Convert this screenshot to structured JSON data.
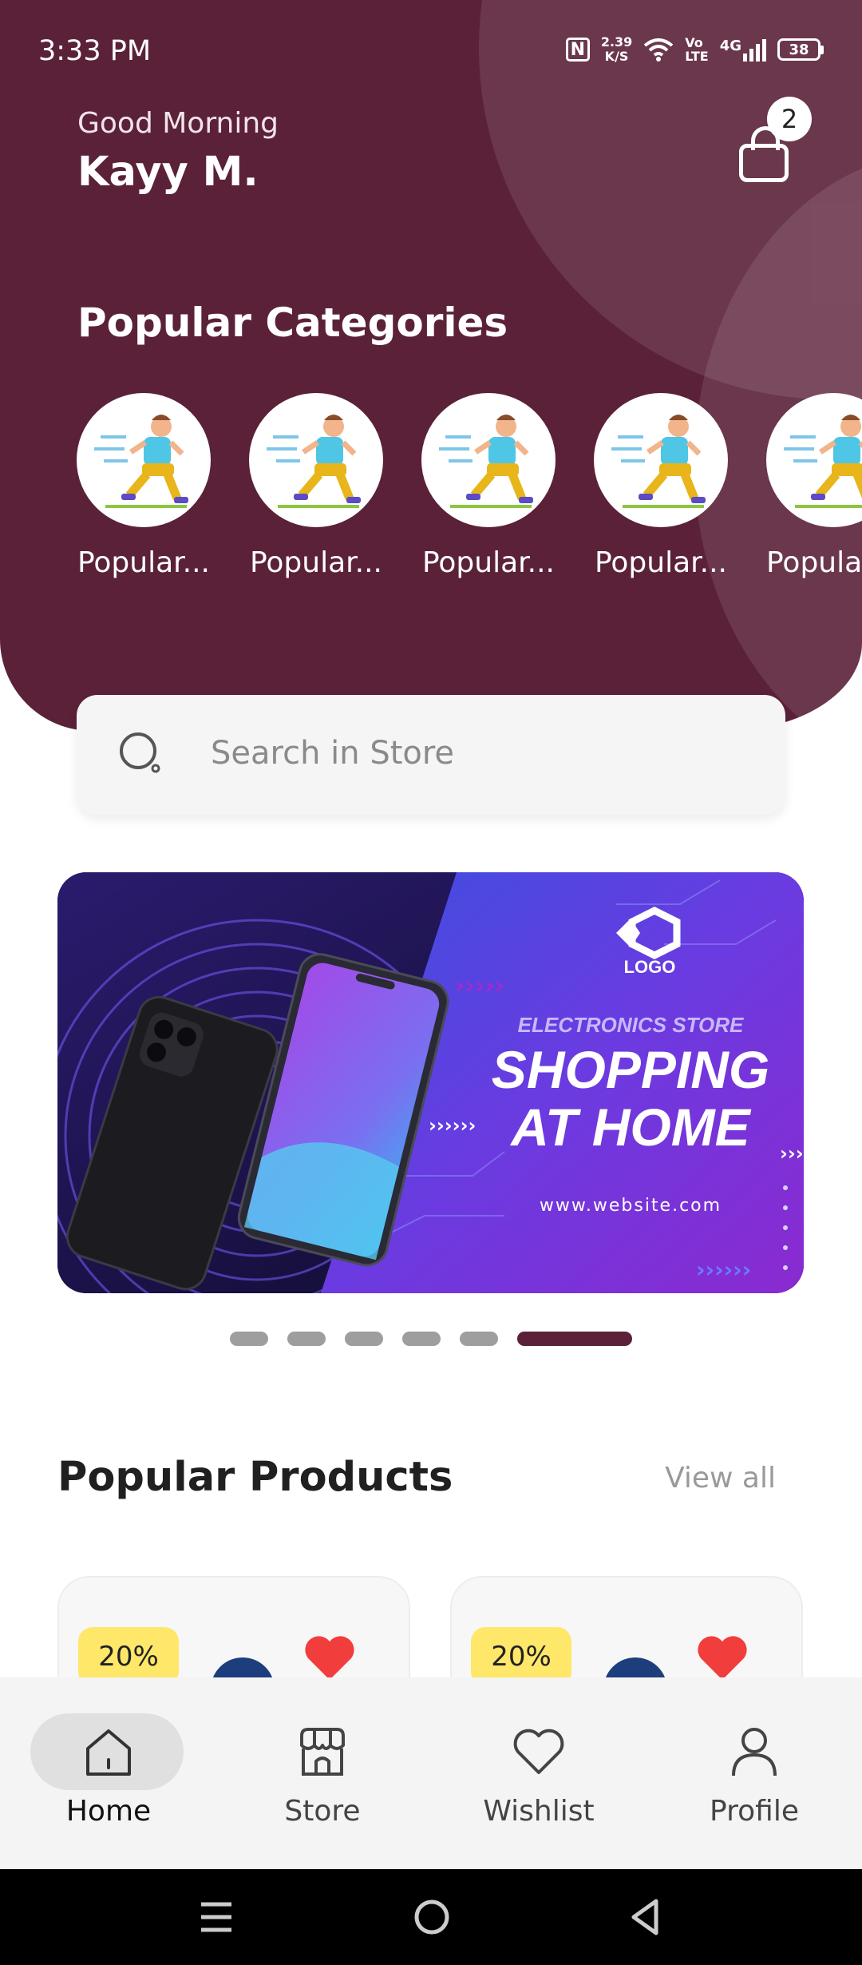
{
  "status_bar": {
    "time": "3:33 PM",
    "nfc": "N",
    "net_speed_value": "2.39",
    "net_speed_unit": "K/S",
    "volte_top": "Vo",
    "volte_bottom": "LTE",
    "network": "4G",
    "battery": "38"
  },
  "header": {
    "greeting": "Good Morning",
    "user_name": "Kayy M.",
    "cart_count": "2",
    "colors": {
      "primary": "#5b2139",
      "badge_bg": "#ffffff"
    }
  },
  "categories": {
    "title": "Popular Categories",
    "items": [
      {
        "label": "Popular..."
      },
      {
        "label": "Popular..."
      },
      {
        "label": "Popular..."
      },
      {
        "label": "Popular..."
      },
      {
        "label": "Popula"
      }
    ]
  },
  "search": {
    "placeholder": "Search in Store",
    "icon": "search-icon"
  },
  "banner": {
    "logo_text": "LOGO",
    "kicker": "ELECTRONICS STORE",
    "headline_line1": "SHOPPING",
    "headline_line2": "AT HOME",
    "url": "www.website.com",
    "slides": {
      "count": 6,
      "active": 6
    }
  },
  "products": {
    "title": "Popular Products",
    "view_all": "View all",
    "items": [
      {
        "discount": "20%",
        "favorited": true
      },
      {
        "discount": "20%",
        "favorited": true
      }
    ]
  },
  "bottom_nav": {
    "items": [
      {
        "label": "Home",
        "icon": "home-icon",
        "active": true
      },
      {
        "label": "Store",
        "icon": "store-icon",
        "active": false
      },
      {
        "label": "Wishlist",
        "icon": "heart-icon",
        "active": false
      },
      {
        "label": "Profile",
        "icon": "user-icon",
        "active": false
      }
    ]
  },
  "system_nav": {
    "icons": [
      "menu-icon",
      "home-circle-icon",
      "back-icon"
    ]
  }
}
